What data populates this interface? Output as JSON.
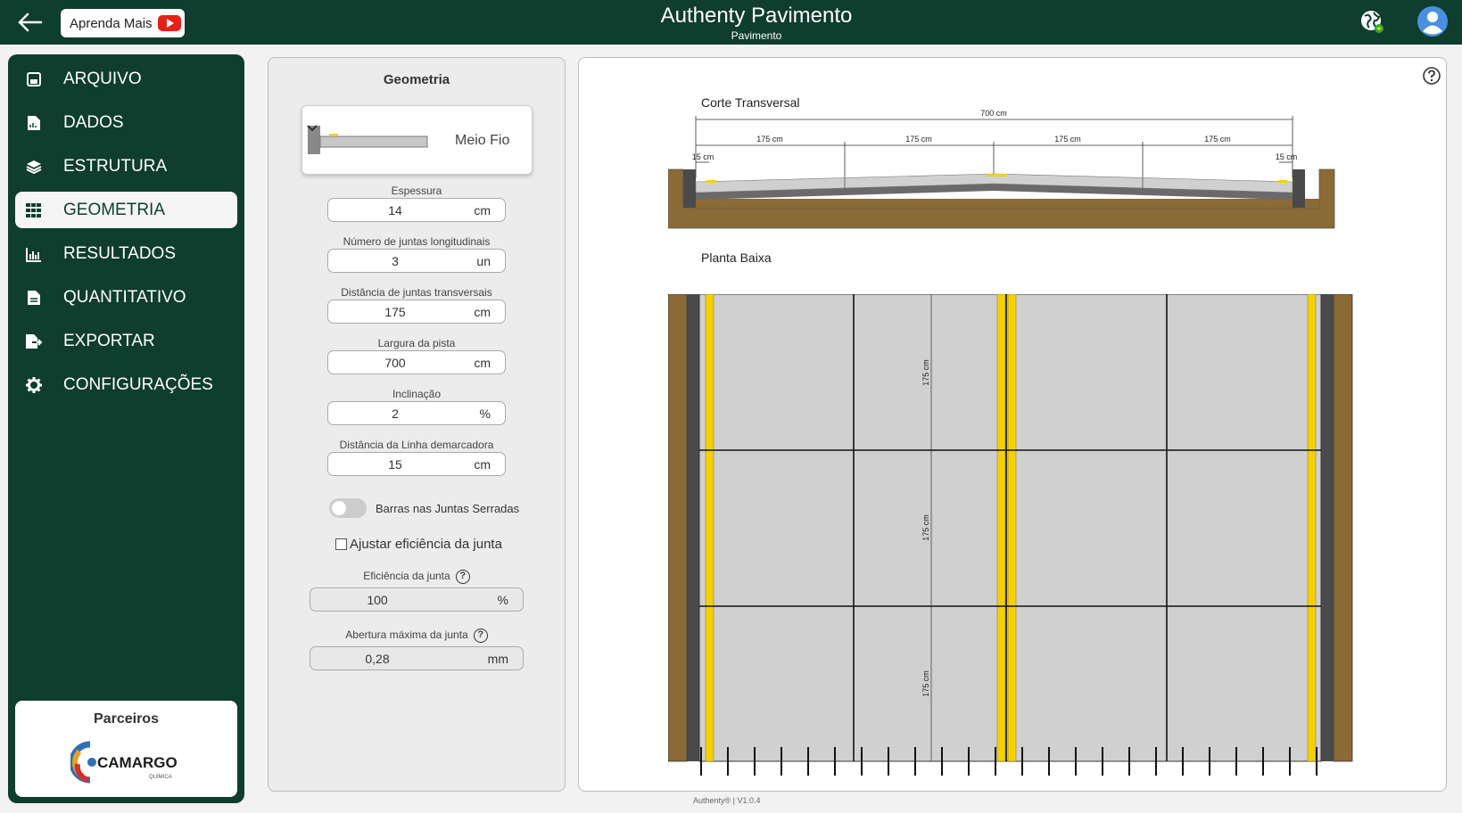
{
  "header": {
    "title": "Authenty Pavimento",
    "subtitle": "Pavimento",
    "learn_more": "Aprenda Mais"
  },
  "sidebar": {
    "items": [
      {
        "label": "ARQUIVO",
        "icon": "save-icon"
      },
      {
        "label": "DADOS",
        "icon": "file-chart-icon"
      },
      {
        "label": "ESTRUTURA",
        "icon": "layers-icon"
      },
      {
        "label": "GEOMETRIA",
        "icon": "grid-icon",
        "active": true
      },
      {
        "label": "RESULTADOS",
        "icon": "bar-chart-icon"
      },
      {
        "label": "QUANTITATIVO",
        "icon": "file-icon"
      },
      {
        "label": "EXPORTAR",
        "icon": "file-export-icon"
      },
      {
        "label": "CONFIGURAÇÕES",
        "icon": "gear-icon"
      }
    ],
    "partners_title": "Parceiros",
    "partner_name": "CAMARGO",
    "partner_sub": "QUÍMICA"
  },
  "geometry": {
    "title": "Geometria",
    "type_label": "Meio Fio",
    "fields": [
      {
        "label": "Espessura",
        "value": "14",
        "unit": "cm"
      },
      {
        "label": "Número de juntas longitudinais",
        "value": "3",
        "unit": "un"
      },
      {
        "label": "Distância de juntas transversais",
        "value": "175",
        "unit": "cm"
      },
      {
        "label": "Largura da pista",
        "value": "700",
        "unit": "cm"
      },
      {
        "label": "Inclinação",
        "value": "2",
        "unit": "%"
      },
      {
        "label": "Distância da Linha demarcadora",
        "value": "15",
        "unit": "cm"
      }
    ],
    "toggle_label": "Barras nas Juntas Serradas",
    "toggle_on": false,
    "checkbox_label": "Ajustar eficiência da junta",
    "checkbox_checked": false,
    "efficiency": {
      "label": "Eficiência da junta",
      "value": "100",
      "unit": "%"
    },
    "opening": {
      "label": "Abertura máxima da junta",
      "value": "0,28",
      "unit": "mm"
    }
  },
  "drawing": {
    "cross_section_title": "Corte Transversal",
    "plan_title": "Planta Baixa",
    "total_width_label": "700 cm",
    "lane_labels": [
      "175 cm",
      "175 cm",
      "175 cm",
      "175 cm"
    ],
    "edge_labels": [
      "15 cm",
      "15 cm"
    ],
    "slab_length_labels": [
      "175 cm",
      "175 cm",
      "175 cm"
    ],
    "colors": {
      "soil": "#8a6a35",
      "concrete": "#d0d0d0",
      "curb": "#4a4a4a",
      "stripe": "#f5d000"
    }
  },
  "footer": {
    "version": "Authenty® | V1.0.4"
  }
}
